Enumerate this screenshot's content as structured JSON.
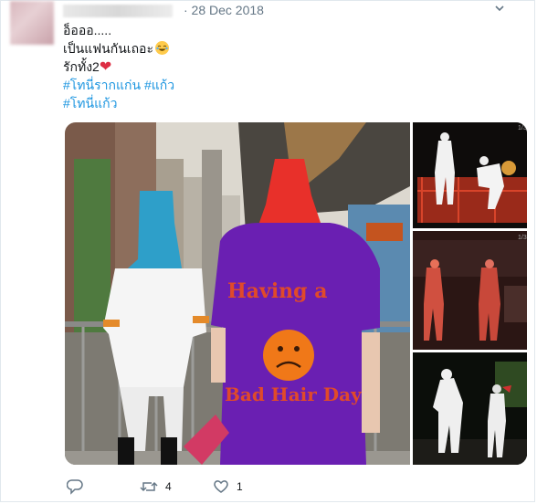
{
  "tweet": {
    "date": "· 28 Dec 2018",
    "lines": [
      "อ็อออ.....",
      "เป็นแฟนกันเถอะ",
      "รักทั้ง2"
    ],
    "hashtags_line1": [
      "#โทนี่รากแก่น",
      "#แก้ว"
    ],
    "hashtags_line2": [
      "#โทนี่แก้ว"
    ]
  },
  "media": {
    "shirt_text_top": "Having a",
    "shirt_text_bottom": "Bad Hair Day",
    "counter_r1": "1/3",
    "counter_r2": "1/3"
  },
  "actions": {
    "reply_count": "",
    "retweet_count": "4",
    "like_count": "1"
  },
  "colors": {
    "link": "#1b95e0",
    "heart": "#dd2e44",
    "muted": "#657786"
  }
}
